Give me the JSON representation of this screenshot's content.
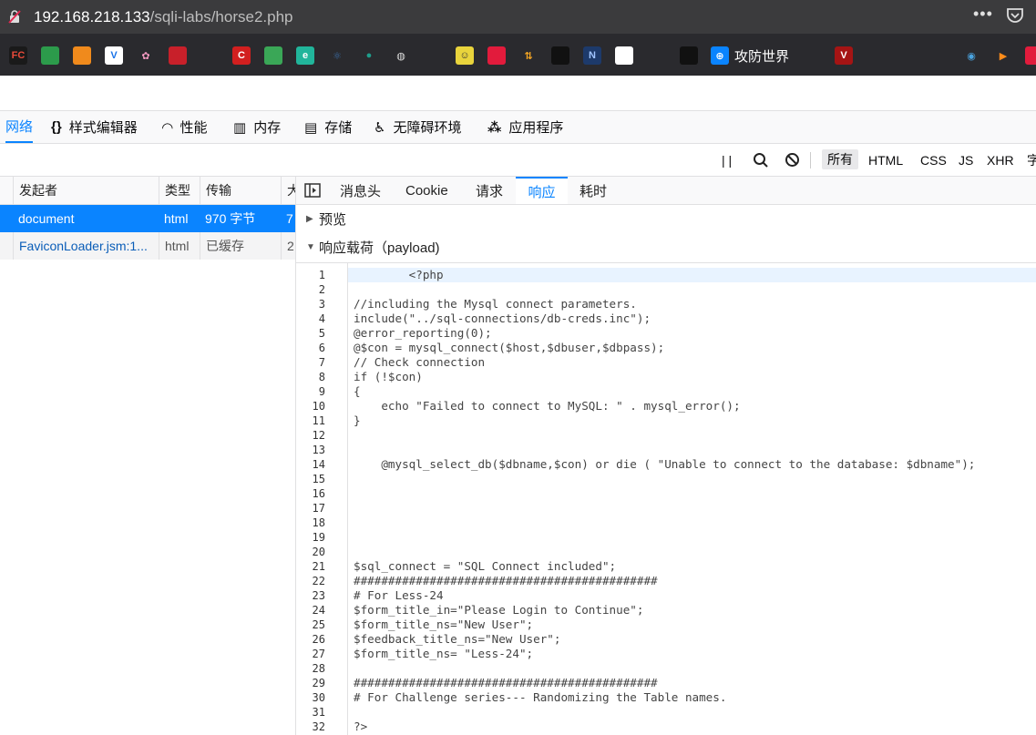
{
  "urlbar": {
    "host": "192.168.218.133",
    "path": "/sqli-labs/horse2.php",
    "more_label": "•••"
  },
  "bookmarks": {
    "items": [
      {
        "name": "fc",
        "label": "FC",
        "bg": "#1a1a1a",
        "fg": "#e84a3a"
      },
      {
        "name": "map",
        "label": "",
        "bg": "#2c9b4b",
        "fg": "#fff"
      },
      {
        "name": "cube",
        "label": "",
        "bg": "#f08a1c",
        "fg": "#fff"
      },
      {
        "name": "v",
        "label": "V",
        "bg": "#ffffff",
        "fg": "#1a73e8"
      },
      {
        "name": "flower",
        "label": "✿",
        "bg": "#2a2a2e",
        "fg": "#f49ac1"
      },
      {
        "name": "seal",
        "label": "",
        "bg": "#c8202a",
        "fg": "#fff"
      },
      {
        "name": "github",
        "label": "",
        "bg": "#2a2a2e",
        "fg": "#fff"
      },
      {
        "name": "c",
        "label": "C",
        "bg": "#d21f1f",
        "fg": "#fff"
      },
      {
        "name": "bars",
        "label": "",
        "bg": "#3aa757",
        "fg": "#fff"
      },
      {
        "name": "e",
        "label": "e",
        "bg": "#21b59b",
        "fg": "#fff"
      },
      {
        "name": "react",
        "label": "⚛",
        "bg": "#2a2a2e",
        "fg": "#3b6ea8"
      },
      {
        "name": "circle",
        "label": "●",
        "bg": "#2a2a2e",
        "fg": "#1e9e8c"
      },
      {
        "name": "globe",
        "label": "◍",
        "bg": "#2a2a2e",
        "fg": "#ddd"
      },
      {
        "name": "link",
        "label": "",
        "bg": "#2a2a2e",
        "fg": "#ff7a1a"
      },
      {
        "name": "face",
        "label": "☺",
        "bg": "#e9d43c",
        "fg": "#333"
      },
      {
        "name": "redsq",
        "label": "",
        "bg": "#e21b3c",
        "fg": "#fff"
      },
      {
        "name": "arrow",
        "label": "⇅",
        "bg": "#2a2a2e",
        "fg": "#f5a623"
      },
      {
        "name": "tile",
        "label": "",
        "bg": "#111",
        "fg": "#fff"
      },
      {
        "name": "n",
        "label": "N",
        "bg": "#1d3a6b",
        "fg": "#9fc4ff"
      },
      {
        "name": "runner",
        "label": "",
        "bg": "#ffffff",
        "fg": "#1a73e8"
      },
      {
        "name": "bird",
        "label": "",
        "bg": "#111",
        "fg": "#fff"
      },
      {
        "name": "gongfang",
        "label": "⊕",
        "bg": "#0a84ff",
        "fg": "#fff"
      },
      {
        "name": "dots",
        "label": "",
        "bg": "#2a2a2e",
        "fg": "#ffcc33"
      },
      {
        "name": "v-red",
        "label": "V",
        "bg": "#a51414",
        "fg": "#fff"
      },
      {
        "name": "r1",
        "label": "",
        "bg": "#2a2a2e",
        "fg": "#e03131"
      },
      {
        "name": "r2",
        "label": "",
        "bg": "#2a2a2e",
        "fg": "#e03131"
      },
      {
        "name": "r3",
        "label": "",
        "bg": "#2a2a2e",
        "fg": "#e03131"
      },
      {
        "name": "earth",
        "label": "◉",
        "bg": "#2a2a2e",
        "fg": "#4aa3df"
      },
      {
        "name": "play",
        "label": "▶",
        "bg": "#2a2a2e",
        "fg": "#ff8c1a"
      },
      {
        "name": "last",
        "label": "",
        "bg": "#e21b3c",
        "fg": "#fff"
      }
    ],
    "text_label": "攻防世界"
  },
  "devtools": {
    "tabs": [
      {
        "icon": "",
        "label": "网络"
      },
      {
        "icon": "{}",
        "label": "样式编辑器"
      },
      {
        "icon": "◠",
        "label": "性能"
      },
      {
        "icon": "▥",
        "label": "内存"
      },
      {
        "icon": "▤",
        "label": "存储"
      },
      {
        "icon": "♿",
        "label": "无障碍环境"
      },
      {
        "icon": "⁂",
        "label": "应用程序"
      }
    ],
    "filter": {
      "pause": "| |",
      "types": [
        "所有",
        "HTML",
        "CSS",
        "JS",
        "XHR",
        "字"
      ]
    }
  },
  "requests": {
    "headers": [
      "发起者",
      "类型",
      "传输",
      "大"
    ],
    "rows": [
      {
        "initiator": "document",
        "type": "html",
        "transfer": "970 字节",
        "size": "7"
      },
      {
        "initiator": "FaviconLoader.jsm:1...",
        "type": "html",
        "transfer": "已缓存",
        "size": "2"
      }
    ]
  },
  "details": {
    "tabs": [
      "消息头",
      "Cookie",
      "请求",
      "响应",
      "耗时"
    ],
    "active_tab": "响应",
    "preview_label": "预览",
    "payload_label": "响应载荷（payload)",
    "code_lines": [
      "        <?php",
      "",
      "//including the Mysql connect parameters.",
      "include(\"../sql-connections/db-creds.inc\");",
      "@error_reporting(0);",
      "@$con = mysql_connect($host,$dbuser,$dbpass);",
      "// Check connection",
      "if (!$con)",
      "{",
      "    echo \"Failed to connect to MySQL: \" . mysql_error();",
      "}",
      "",
      "",
      "    @mysql_select_db($dbname,$con) or die ( \"Unable to connect to the database: $dbname\");",
      "",
      "",
      "",
      "",
      "",
      "",
      "$sql_connect = \"SQL Connect included\";",
      "############################################",
      "# For Less-24",
      "$form_title_in=\"Please Login to Continue\";",
      "$form_title_ns=\"New User\";",
      "$feedback_title_ns=\"New User\";",
      "$form_title_ns= \"Less-24\";",
      "",
      "############################################",
      "# For Challenge series--- Randomizing the Table names.",
      "",
      "?>"
    ]
  }
}
